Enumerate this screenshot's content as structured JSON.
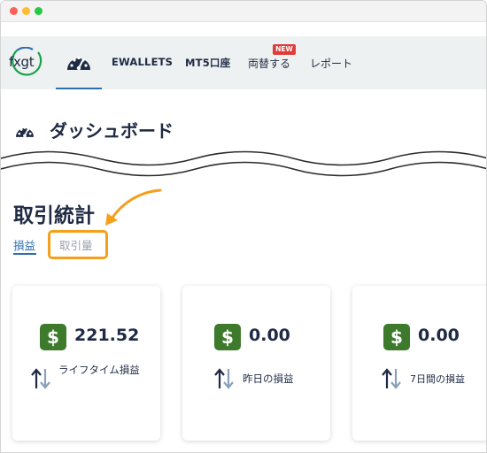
{
  "nav": {
    "logo_text": "fxgt",
    "items": [
      {
        "label": "EWALLETS"
      },
      {
        "label": "MT5口座"
      },
      {
        "label": "両替する"
      },
      {
        "label": "レポート"
      }
    ],
    "new_badge": "NEW",
    "active_icon": "speedometer-icon"
  },
  "page": {
    "title": "ダッシュボード",
    "title_icon": "speedometer-icon"
  },
  "stats": {
    "title": "取引統計",
    "tabs": [
      {
        "label": "損益",
        "active": true
      },
      {
        "label": "取引量",
        "active": false,
        "highlighted": true
      }
    ]
  },
  "cards": [
    {
      "value": "221.52",
      "label": "ライフタイム損益",
      "icon": "dollar-icon"
    },
    {
      "value": "0.00",
      "label": "昨日の損益",
      "icon": "dollar-icon"
    },
    {
      "value": "0.00",
      "label": "7日間の損益",
      "icon": "dollar-icon"
    }
  ],
  "colors": {
    "accent": "#2e6fb0",
    "highlight": "#f4a01c",
    "dollar_bg": "#3d7a2b",
    "badge": "#e03a3a",
    "navbar_bg": "#eef1f1"
  }
}
